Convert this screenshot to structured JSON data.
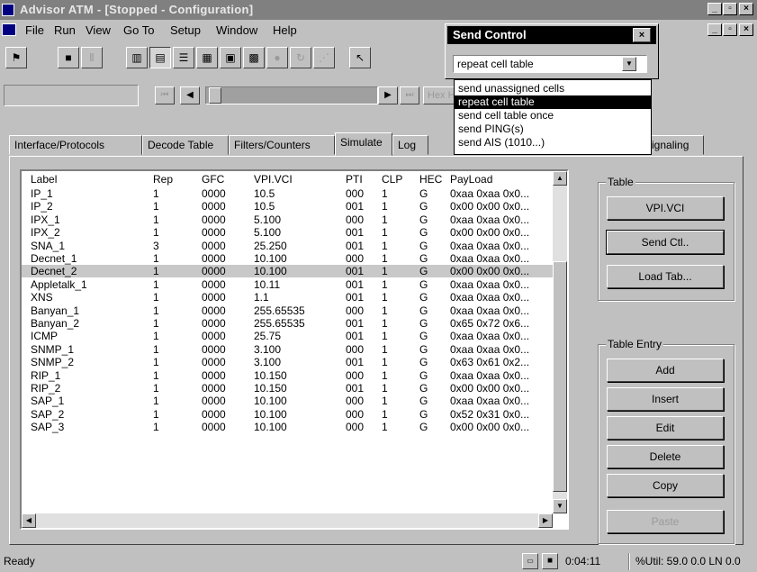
{
  "window": {
    "title": "Advisor ATM - [Stopped - Configuration]",
    "min_label": "_",
    "max_label": "▫",
    "close_label": "×"
  },
  "menu": [
    "File",
    "Run",
    "View",
    "Go To",
    "Setup",
    "Window",
    "Help"
  ],
  "tabs": [
    "Interface/Protocols",
    "Decode Table",
    "Filters/Counters",
    "Simulate",
    "Log",
    "Signaling"
  ],
  "active_tab": "Simulate",
  "toolbar": {
    "hex_label": "Hex H"
  },
  "send_control": {
    "title": "Send Control",
    "close_label": "×",
    "selected": "repeat cell table",
    "options": [
      "send unassigned cells",
      "repeat cell table",
      "send cell table once",
      "send PING(s)",
      "send AIS (1010...)"
    ]
  },
  "grid": {
    "columns": [
      "Label",
      "Rep",
      "GFC",
      "VPI.VCI",
      "PTI",
      "CLP",
      "HEC",
      "PayLoad"
    ],
    "rows": [
      [
        "IP_1",
        "1",
        "0000",
        "10.5",
        "000",
        "1",
        "G",
        "0xaa 0xaa 0x0..."
      ],
      [
        "IP_2",
        "1",
        "0000",
        "10.5",
        "001",
        "1",
        "G",
        "0x00 0x00 0x0..."
      ],
      [
        "IPX_1",
        "1",
        "0000",
        "5.100",
        "000",
        "1",
        "G",
        "0xaa 0xaa 0x0..."
      ],
      [
        "IPX_2",
        "1",
        "0000",
        "5.100",
        "001",
        "1",
        "G",
        "0x00 0x00 0x0..."
      ],
      [
        "SNA_1",
        "3",
        "0000",
        "25.250",
        "001",
        "1",
        "G",
        "0xaa 0xaa 0x0..."
      ],
      [
        "Decnet_1",
        "1",
        "0000",
        "10.100",
        "000",
        "1",
        "G",
        "0xaa 0xaa 0x0..."
      ],
      [
        "Decnet_2",
        "1",
        "0000",
        "10.100",
        "001",
        "1",
        "G",
        "0x00 0x00 0x0..."
      ],
      [
        "Appletalk_1",
        "1",
        "0000",
        "10.11",
        "001",
        "1",
        "G",
        "0xaa 0xaa 0x0..."
      ],
      [
        "XNS",
        "1",
        "0000",
        "1.1",
        "001",
        "1",
        "G",
        "0xaa 0xaa 0x0..."
      ],
      [
        "Banyan_1",
        "1",
        "0000",
        "255.65535",
        "000",
        "1",
        "G",
        "0xaa 0xaa 0x0..."
      ],
      [
        "Banyan_2",
        "1",
        "0000",
        "255.65535",
        "001",
        "1",
        "G",
        "0x65 0x72 0x6..."
      ],
      [
        "ICMP",
        "1",
        "0000",
        "25.75",
        "001",
        "1",
        "G",
        "0xaa 0xaa 0x0..."
      ],
      [
        "SNMP_1",
        "1",
        "0000",
        "3.100",
        "000",
        "1",
        "G",
        "0xaa 0xaa 0x0..."
      ],
      [
        "SNMP_2",
        "1",
        "0000",
        "3.100",
        "001",
        "1",
        "G",
        "0x63 0x61 0x2..."
      ],
      [
        "RIP_1",
        "1",
        "0000",
        "10.150",
        "000",
        "1",
        "G",
        "0xaa 0xaa 0x0..."
      ],
      [
        "RIP_2",
        "1",
        "0000",
        "10.150",
        "001",
        "1",
        "G",
        "0x00 0x00 0x0..."
      ],
      [
        "SAP_1",
        "1",
        "0000",
        "10.100",
        "000",
        "1",
        "G",
        "0xaa 0xaa 0x0..."
      ],
      [
        "SAP_2",
        "1",
        "0000",
        "10.100",
        "000",
        "1",
        "G",
        "0x52 0x31 0x0..."
      ],
      [
        "SAP_3",
        "1",
        "0000",
        "10.100",
        "000",
        "1",
        "G",
        "0x00 0x00 0x0..."
      ]
    ],
    "selected_row": 6
  },
  "table_group": {
    "legend": "Table",
    "buttons": [
      "VPI.VCI",
      "Send Ctl..",
      "Load Tab..."
    ]
  },
  "entry_group": {
    "legend": "Table Entry",
    "buttons": [
      "Add",
      "Insert",
      "Edit",
      "Delete",
      "Copy",
      "Paste"
    ]
  },
  "status": {
    "text": "Ready",
    "time": "0:04:11",
    "util": "%Util: 59.0 0.0  LN 0.0"
  }
}
